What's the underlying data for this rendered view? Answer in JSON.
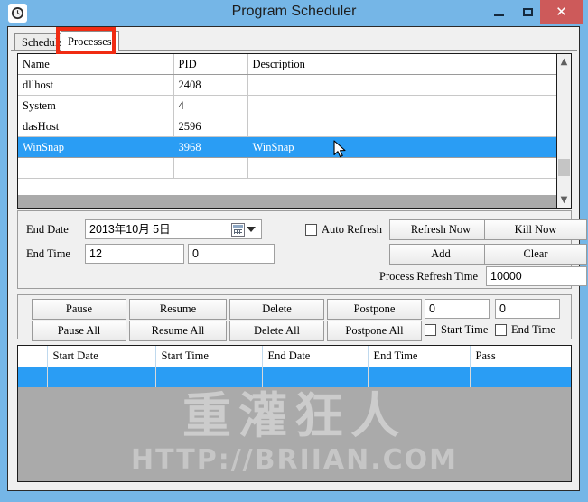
{
  "window": {
    "title": "Program Scheduler",
    "icon": "clock-icon",
    "minimize_label": "–",
    "maximize_label": "□",
    "close_label": "✕",
    "accent_color": "#75b6e7",
    "close_color": "#cd5a5a"
  },
  "tabs": [
    {
      "label": "Schedule",
      "active": false
    },
    {
      "label": "Processes",
      "active": true
    }
  ],
  "annotation": {
    "color": "#f02b12",
    "target": "Processes"
  },
  "process_list": {
    "columns": [
      "Name",
      "PID",
      "Description"
    ],
    "rows": [
      {
        "name": "dllhost",
        "pid": "2408",
        "description": "",
        "selected": false
      },
      {
        "name": "System",
        "pid": "4",
        "description": "",
        "selected": false
      },
      {
        "name": "dasHost",
        "pid": "2596",
        "description": "",
        "selected": false
      },
      {
        "name": "WinSnap",
        "pid": "3968",
        "description": "WinSnap",
        "selected": true
      },
      {
        "name": "",
        "pid": "",
        "description": "",
        "selected": false
      }
    ],
    "selection_color": "#2a9df4",
    "scrollbar": {
      "up_arrow": "▲",
      "down_arrow": "▼"
    }
  },
  "settings": {
    "end_date_label": "End Date",
    "end_date_value": "2013年10月  5日",
    "end_time_label": "End Time",
    "end_time_hours": "12",
    "end_time_minutes": "0",
    "auto_refresh_label": "Auto Refresh",
    "auto_refresh_checked": false,
    "refresh_now_label": "Refresh Now",
    "kill_now_label": "Kill Now",
    "add_label": "Add",
    "clear_label": "Clear",
    "process_refresh_time_label": "Process Refresh Time",
    "process_refresh_time_value": "10000"
  },
  "actions": {
    "pause_label": "Pause",
    "resume_label": "Resume",
    "delete_label": "Delete",
    "postpone_label": "Postpone",
    "pause_all_label": "Pause All",
    "resume_all_label": "Resume All",
    "delete_all_label": "Delete All",
    "postpone_all_label": "Postpone All",
    "postpone_value_1": "0",
    "postpone_value_2": "0",
    "start_time_label": "Start Time",
    "start_time_checked": false,
    "end_time_label": "End Time",
    "end_time_checked": false
  },
  "schedule_grid": {
    "columns": [
      "",
      "Start Date",
      "Start Time",
      "End Date",
      "End Time",
      "Pass"
    ],
    "rows": [
      {
        "cells": [
          "",
          "",
          "",
          "",
          "",
          ""
        ],
        "selected": true
      }
    ],
    "selection_color": "#2a9df4",
    "empty_background": "#aaaaaa"
  },
  "watermark": {
    "primary": "重灌狂人",
    "secondary": "HTTP://BRIIAN.COM"
  }
}
